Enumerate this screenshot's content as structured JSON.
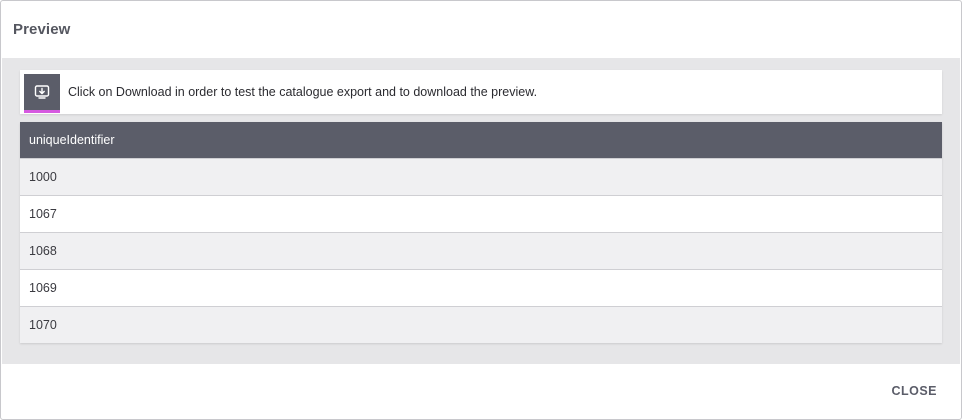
{
  "dialog": {
    "title": "Preview",
    "close_label": "CLOSE"
  },
  "info": {
    "icon": "download-icon",
    "message": "Click on Download in order to test the catalogue export and to download the preview.",
    "accent_color": "#d659e0"
  },
  "table": {
    "columns": [
      "uniqueIdentifier"
    ],
    "rows": [
      [
        "1000"
      ],
      [
        "1067"
      ],
      [
        "1068"
      ],
      [
        "1069"
      ],
      [
        "1070"
      ]
    ]
  },
  "colors": {
    "header_bg": "#5b5d69",
    "body_bg": "#e6e6e8"
  }
}
